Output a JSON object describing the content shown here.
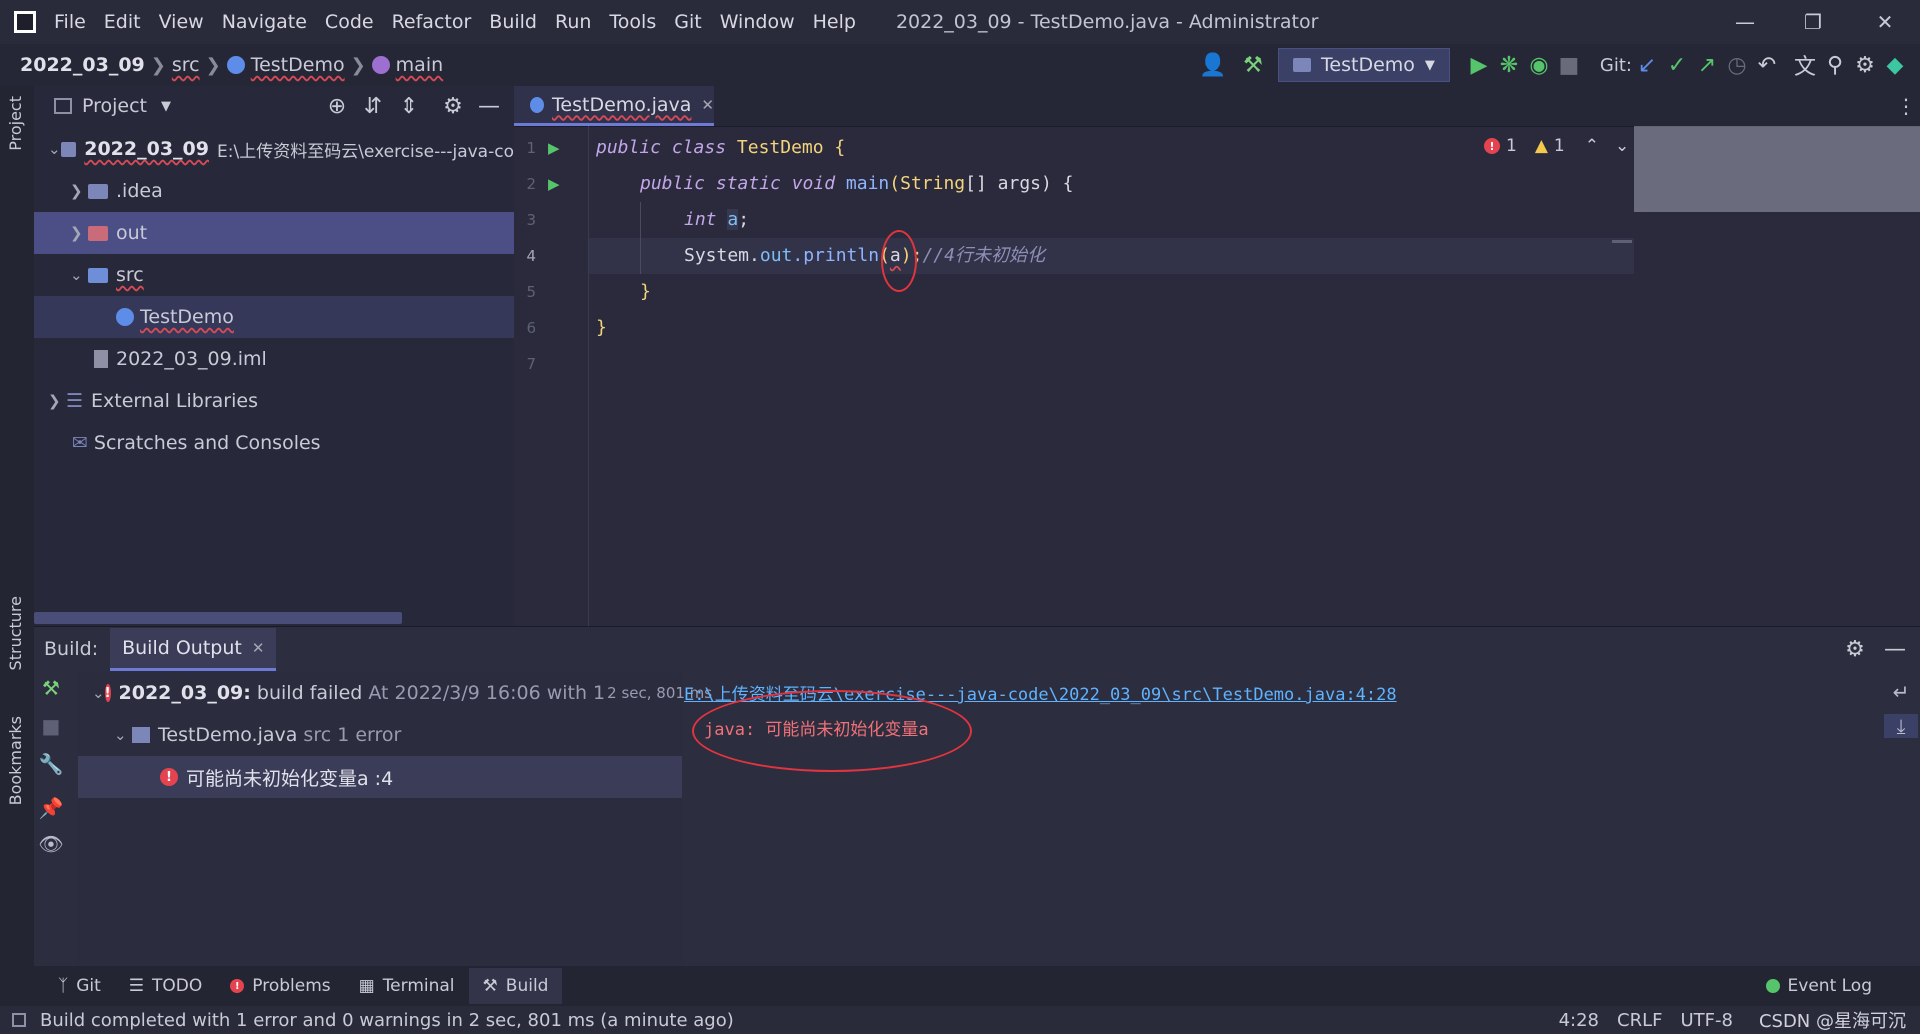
{
  "menu": {
    "items": [
      "File",
      "Edit",
      "View",
      "Navigate",
      "Code",
      "Refactor",
      "Build",
      "Run",
      "Tools",
      "Git",
      "Window",
      "Help"
    ],
    "title": "2022_03_09 - TestDemo.java - Administrator"
  },
  "nav": {
    "project": "2022_03_09",
    "src": "src",
    "class": "TestDemo",
    "method": "main",
    "run_config": "TestDemo",
    "git_label": "Git:"
  },
  "project_panel": {
    "title": "Project",
    "root_name": "2022_03_09",
    "root_path": "E:\\上传资料至码云\\exercise---java-co",
    "items": [
      ".idea",
      "out",
      "src",
      "TestDemo",
      "2022_03_09.iml",
      "External Libraries",
      "Scratches and Consoles"
    ]
  },
  "editor": {
    "tab_label": "TestDemo.java",
    "line_numbers": [
      "1",
      "2",
      "3",
      "4",
      "5",
      "6",
      "7"
    ],
    "error_count": "1",
    "warning_count": "1",
    "code": {
      "l1_kw": "public class ",
      "l1_cls": "TestDemo",
      "l1_rest": " {",
      "l2_kw": "public static void ",
      "l2_fn": "main",
      "l2_rest1": "(",
      "l2_type": "String",
      "l2_rest2": "[] args) {",
      "l3_kw": "int ",
      "l3_var": "a",
      "l3_rest": ";",
      "l4_a": "System.",
      "l4_out": "out",
      "l4_b": ".println",
      "l4_c": "(",
      "l4_var": "a",
      "l4_d": ");",
      "l4_cmt": "//4行未初始化",
      "l5": "}",
      "l6": "}"
    }
  },
  "build": {
    "label": "Build:",
    "tab": "Build Output",
    "summary_bold": "2022_03_09:",
    "summary_status": " build failed ",
    "summary_time": "At 2022/3/9 16:06 with 1",
    "summary_dur_small": "2 sec, 801 ms",
    "file_name": "TestDemo.java",
    "file_path": " src 1 error",
    "error_msg": "可能尚未初始化变量a :4",
    "output_link": "E:\\上传资料至码云\\exercise---java-code\\2022_03_09\\src\\TestDemo.java:4:28",
    "output_error": "java: 可能尚未初始化变量a"
  },
  "bottom_tabs": [
    "Git",
    "TODO",
    "Problems",
    "Terminal",
    "Build"
  ],
  "side_labels": {
    "project": "Project",
    "structure": "Structure",
    "bookmarks": "Bookmarks"
  },
  "status": {
    "message": "Build completed with 1 error and 0 warnings in 2 sec, 801 ms (a minute ago)",
    "position": "4:28",
    "line_sep": "CRLF",
    "encoding": "UTF-8",
    "event_log": "Event Log",
    "watermark": "CSDN @星海可沉"
  },
  "colors": {
    "accent": "#6d7bd6",
    "error": "#e5434f",
    "selection": "#4c4f86"
  }
}
